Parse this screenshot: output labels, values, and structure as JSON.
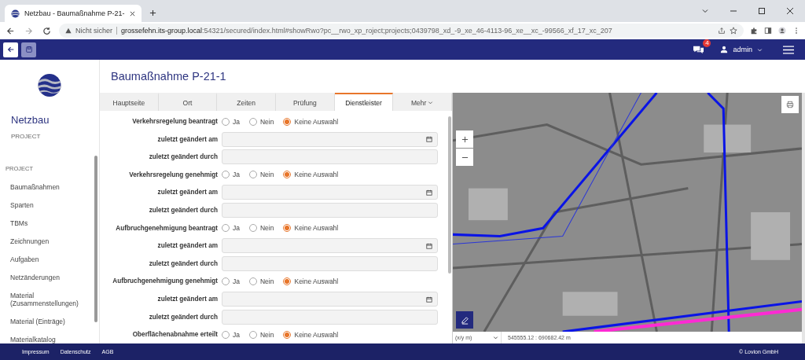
{
  "browser": {
    "tab_title": "Netzbau - Baumaßnahme P-21-",
    "security": "Nicht sicher",
    "url": {
      "host": "grossefehn.its-group.local",
      "path": ":54321/secured/index.html#showRwo?pc__rwo_xp_roject;projects;0439798_xd_-9_xe_46-4113-96_xe__xc_-99566_xf_17_xc_207"
    }
  },
  "header": {
    "save_disabled": true,
    "notifications": "4",
    "user": "admin"
  },
  "sidebar": {
    "app_name": "Netzbau",
    "app_sub": "PROJECT",
    "section": "PROJECT",
    "items": [
      {
        "label": "Baumaßnahmen"
      },
      {
        "label": "Sparten"
      },
      {
        "label": "TBMs"
      },
      {
        "label": "Zeichnungen"
      },
      {
        "label": "Aufgaben"
      },
      {
        "label": "Netzänderungen"
      },
      {
        "label": "Material (Zusammenstellungen)"
      },
      {
        "label": "Material (Einträge)"
      },
      {
        "label": "Materialkatalog"
      }
    ]
  },
  "page": {
    "title": "Baumaßnahme P-21-1"
  },
  "tabs": [
    {
      "label": "Hauptseite",
      "selected": false
    },
    {
      "label": "Ort",
      "selected": false
    },
    {
      "label": "Zeiten",
      "selected": false
    },
    {
      "label": "Prüfung",
      "selected": false
    },
    {
      "label": "Dienstleister",
      "selected": true
    },
    {
      "label": "Mehr",
      "selected": false,
      "kind": "menu"
    }
  ],
  "form": [
    {
      "kind": "radio",
      "label": "Verkehrsregelung beantragt",
      "options": [
        {
          "label": "Ja",
          "selected": false
        },
        {
          "label": "Nein",
          "selected": false
        },
        {
          "label": "Keine Auswahl",
          "selected": true
        }
      ]
    },
    {
      "kind": "date",
      "label": "zuletzt geändert am"
    },
    {
      "kind": "text",
      "label": "zuletzt geändert durch"
    },
    {
      "kind": "radio",
      "label": "Verkehrsregelung genehmigt",
      "options": [
        {
          "label": "Ja",
          "selected": false
        },
        {
          "label": "Nein",
          "selected": false
        },
        {
          "label": "Keine Auswahl",
          "selected": true
        }
      ]
    },
    {
      "kind": "date",
      "label": "zuletzt geändert am"
    },
    {
      "kind": "text",
      "label": "zuletzt geändert durch"
    },
    {
      "kind": "radio",
      "label": "Aufbruchgenehmigung beantragt",
      "options": [
        {
          "label": "Ja",
          "selected": false
        },
        {
          "label": "Nein",
          "selected": false
        },
        {
          "label": "Keine Auswahl",
          "selected": true
        }
      ]
    },
    {
      "kind": "date",
      "label": "zuletzt geändert am"
    },
    {
      "kind": "text",
      "label": "zuletzt geändert durch"
    },
    {
      "kind": "radio",
      "label": "Aufbruchgenehmigung genehmigt",
      "options": [
        {
          "label": "Ja",
          "selected": false
        },
        {
          "label": "Nein",
          "selected": false
        },
        {
          "label": "Keine Auswahl",
          "selected": true
        }
      ]
    },
    {
      "kind": "date",
      "label": "zuletzt geändert am"
    },
    {
      "kind": "text",
      "label": "zuletzt geändert durch"
    },
    {
      "kind": "radio",
      "label": "Oberflächenabnahme erteilt",
      "options": [
        {
          "label": "Ja",
          "selected": false
        },
        {
          "label": "Nein",
          "selected": false
        },
        {
          "label": "Keine Auswahl",
          "selected": true
        }
      ]
    }
  ],
  "map": {
    "projection": "(x/y m)",
    "coordinates": "545555.12 : 690682.42 m"
  },
  "footer": {
    "links": [
      "Impressum",
      "Datenschutz",
      "AGB"
    ],
    "copyright": "© Lovion GmbH"
  }
}
